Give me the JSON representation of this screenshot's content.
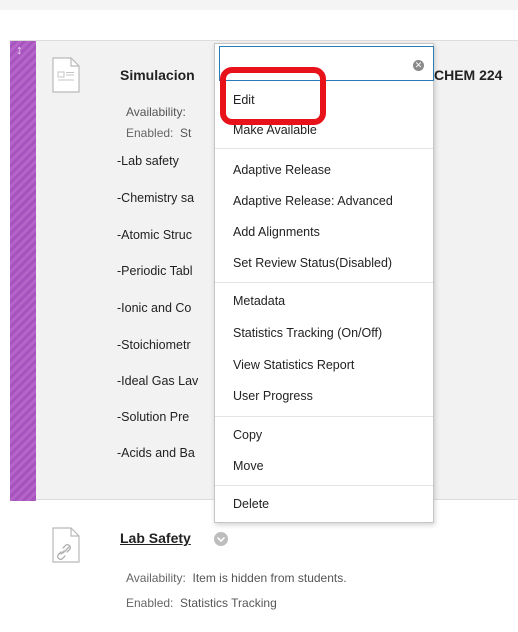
{
  "item1": {
    "title_visible": "Simulacion",
    "title_tail": "CHEM 224",
    "availability_label": "Availability:",
    "enabled_label": "Enabled:",
    "enabled_value": "St",
    "topics": [
      "-Lab safety",
      "-Chemistry sa",
      "-Atomic Struc",
      "-Periodic Tabl",
      "-Ionic and Co",
      "-Stoichiometr",
      "-Ideal Gas Lav",
      "-Solution Pre",
      "-Acids and Ba"
    ],
    "icon": "document-icon",
    "handle_icon": "drag-handle-icon"
  },
  "menu": {
    "search_value": "",
    "clear_icon": "clear-icon",
    "items": [
      "Edit",
      "Make Available",
      "Adaptive Release",
      "Adaptive Release: Advanced",
      "Add Alignments",
      "Set Review Status(Disabled)",
      "Metadata",
      "Statistics Tracking (On/Off)",
      "View Statistics Report",
      "User Progress",
      "Copy",
      "Move",
      "Delete"
    ],
    "highlight_color": "#e8121b"
  },
  "item2": {
    "title": "Lab Safety",
    "availability_label": "Availability:",
    "availability_value": "Item is hidden from students.",
    "enabled_label": "Enabled:",
    "enabled_value": "Statistics Tracking",
    "icon": "link-document-icon",
    "chevron_icon": "chevron-down-icon"
  },
  "colors": {
    "handle": "#b565c9",
    "focus_border": "#2a7ab8",
    "highlight": "#e8121b"
  }
}
